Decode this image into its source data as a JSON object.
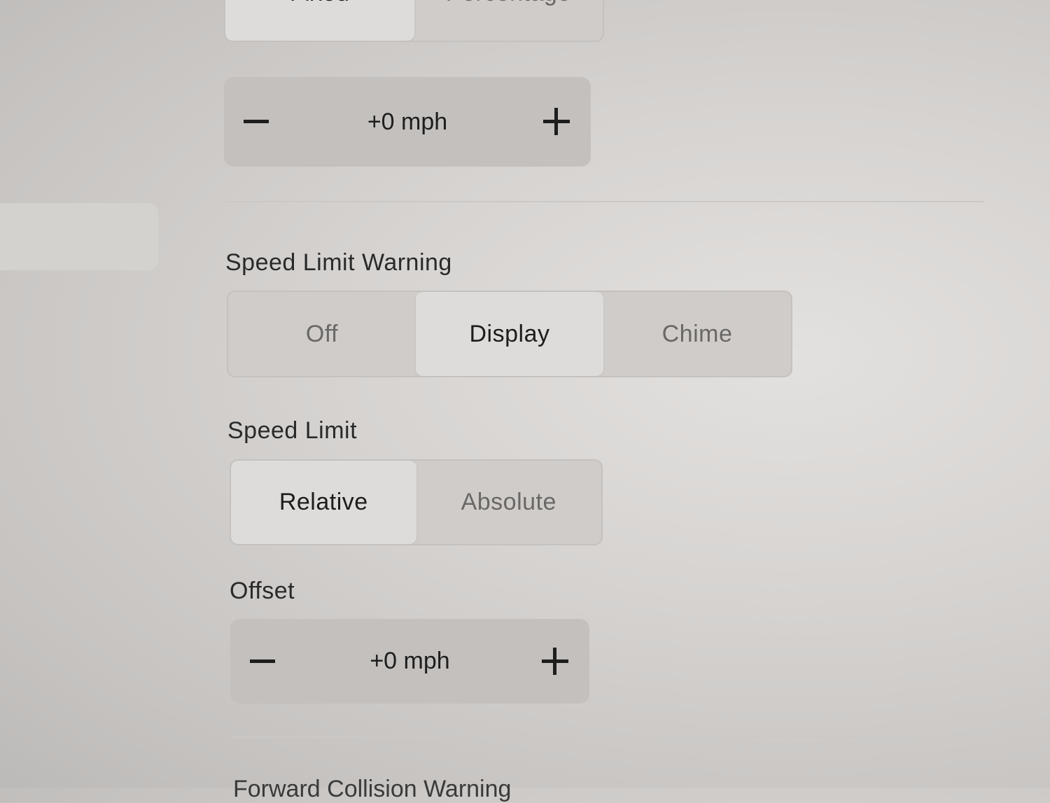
{
  "top_mode": {
    "options": [
      "Fixed",
      "Percentage"
    ],
    "selected": "Fixed"
  },
  "top_stepper": {
    "value": "+0 mph"
  },
  "speed_limit_warning": {
    "label": "Speed Limit Warning",
    "options": [
      "Off",
      "Display",
      "Chime"
    ],
    "selected": "Display"
  },
  "speed_limit": {
    "label": "Speed Limit",
    "options": [
      "Relative",
      "Absolute"
    ],
    "selected": "Relative"
  },
  "offset": {
    "label": "Offset",
    "value": "+0 mph"
  },
  "next_section": {
    "label": "Forward Collision Warning"
  },
  "colors": {
    "selected_segment": "#dedcda",
    "segment_track": "#cfccc9",
    "stepper_background": "#c3c0bd",
    "text": "#1e1e1e"
  },
  "icons": [
    "minus-icon",
    "plus-icon"
  ]
}
